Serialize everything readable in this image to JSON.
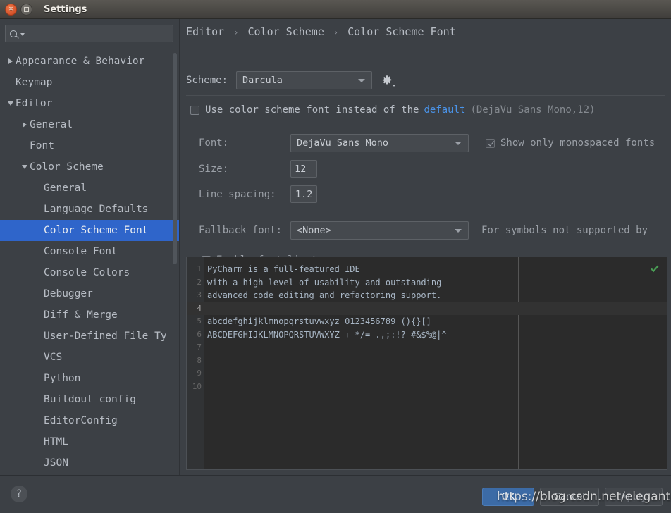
{
  "window": {
    "title": "Settings",
    "close_icon": "close-icon",
    "maximize_icon": "maximize-icon"
  },
  "sidebar": {
    "search": {
      "value": "",
      "placeholder": "",
      "icon": "search-icon"
    },
    "items": [
      {
        "label": "Appearance & Behavior",
        "indent": 0,
        "arrow": "collapsed",
        "selected": false
      },
      {
        "label": "Keymap",
        "indent": 0,
        "arrow": "none",
        "selected": false
      },
      {
        "label": "Editor",
        "indent": 0,
        "arrow": "expanded",
        "selected": false
      },
      {
        "label": "General",
        "indent": 1,
        "arrow": "collapsed",
        "selected": false
      },
      {
        "label": "Font",
        "indent": 1,
        "arrow": "none",
        "selected": false
      },
      {
        "label": "Color Scheme",
        "indent": 1,
        "arrow": "expanded",
        "selected": false
      },
      {
        "label": "General",
        "indent": 2,
        "arrow": "none",
        "selected": false
      },
      {
        "label": "Language Defaults",
        "indent": 2,
        "arrow": "none",
        "selected": false
      },
      {
        "label": "Color Scheme Font",
        "indent": 2,
        "arrow": "none",
        "selected": true
      },
      {
        "label": "Console Font",
        "indent": 2,
        "arrow": "none",
        "selected": false
      },
      {
        "label": "Console Colors",
        "indent": 2,
        "arrow": "none",
        "selected": false
      },
      {
        "label": "Debugger",
        "indent": 2,
        "arrow": "none",
        "selected": false
      },
      {
        "label": "Diff & Merge",
        "indent": 2,
        "arrow": "none",
        "selected": false
      },
      {
        "label": "User-Defined File Ty",
        "indent": 2,
        "arrow": "none",
        "selected": false
      },
      {
        "label": "VCS",
        "indent": 2,
        "arrow": "none",
        "selected": false
      },
      {
        "label": "Python",
        "indent": 2,
        "arrow": "none",
        "selected": false
      },
      {
        "label": "Buildout config",
        "indent": 2,
        "arrow": "none",
        "selected": false
      },
      {
        "label": "EditorConfig",
        "indent": 2,
        "arrow": "none",
        "selected": false
      },
      {
        "label": "HTML",
        "indent": 2,
        "arrow": "none",
        "selected": false
      },
      {
        "label": "JSON",
        "indent": 2,
        "arrow": "none",
        "selected": false
      }
    ]
  },
  "main": {
    "breadcrumb": [
      "Editor",
      "Color Scheme",
      "Color Scheme Font"
    ],
    "breadcrumb_separator": "›",
    "scheme": {
      "label": "Scheme:",
      "value": "Darcula",
      "gear_icon": "gear-icon"
    },
    "use_scheme_font": {
      "checked": false,
      "text_before": "Use color scheme font instead of the",
      "link": "default",
      "suffix": "(DejaVu Sans Mono,12)"
    },
    "font": {
      "label": "Font:",
      "value": "DejaVu Sans Mono"
    },
    "monospaced": {
      "label": "Show only monospaced fonts",
      "checked": true,
      "disabled": true
    },
    "size": {
      "label": "Size:",
      "value": "12"
    },
    "line_spacing": {
      "label": "Line spacing:",
      "value": "1.2"
    },
    "fallback": {
      "label": "Fallback font:",
      "value": "<None>",
      "hint": "For symbols not supported by"
    },
    "ligatures": {
      "label": "Enable font ligatures",
      "checked": false
    },
    "preview": {
      "status_icon": "checkmark-ok-icon",
      "lines": [
        {
          "number": "1",
          "text": "PyCharm is a full-featured IDE",
          "caret": false
        },
        {
          "number": "2",
          "text": "with a high level of usability and outstanding",
          "caret": false
        },
        {
          "number": "3",
          "text": "advanced code editing and refactoring support.",
          "caret": false
        },
        {
          "number": "4",
          "text": "",
          "caret": true
        },
        {
          "number": "5",
          "text": "abcdefghijklmnopqrstuvwxyz 0123456789 (){}[]",
          "caret": false
        },
        {
          "number": "6",
          "text": "ABCDEFGHIJKLMNOPQRSTUVWXYZ +-*/= .,;:!? #&$%@|^",
          "caret": false
        },
        {
          "number": "7",
          "text": "",
          "caret": false
        },
        {
          "number": "8",
          "text": "",
          "caret": false
        },
        {
          "number": "9",
          "text": "",
          "caret": false
        },
        {
          "number": "10",
          "text": "",
          "caret": false
        }
      ]
    }
  },
  "footer": {
    "help_label": "?",
    "ok": "OK",
    "cancel": "Cancel",
    "apply": "Apply"
  },
  "overlay": {
    "watermark": "https://blog.csdn.net/elegantoo"
  },
  "colors": {
    "accent_selection": "#2f65ca",
    "link": "#4a93e8",
    "window_bg": "#3c4045",
    "editor_bg": "#2b2b2b",
    "primary_button": "#3c6ba6",
    "status_ok": "#499c54"
  }
}
